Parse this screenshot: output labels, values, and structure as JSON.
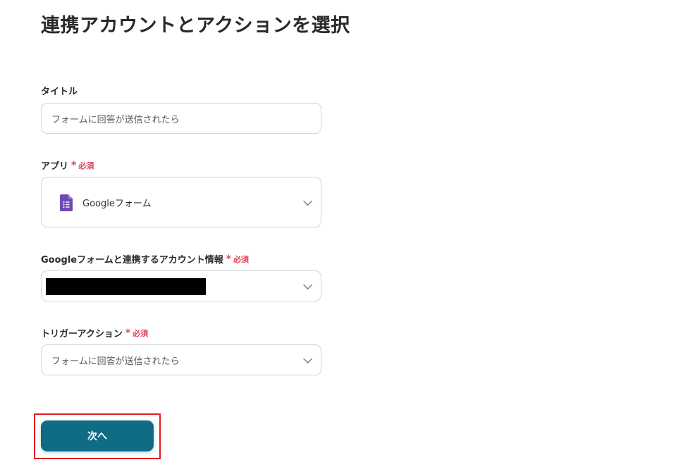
{
  "page": {
    "title": "連携アカウントとアクションを選択"
  },
  "fields": {
    "title_field": {
      "label": "タイトル",
      "value": "フォームに回答が送信されたら"
    },
    "app_field": {
      "label": "アプリ",
      "required_mark": "必須",
      "value": "Googleフォーム",
      "icon": "google-forms-icon"
    },
    "account_field": {
      "label": "Googleフォームと連携するアカウント情報",
      "required_mark": "必須",
      "value_redacted": true
    },
    "trigger_field": {
      "label": "トリガーアクション",
      "required_mark": "必須",
      "value": "フォームに回答が送信されたら"
    }
  },
  "actions": {
    "next_label": "次へ"
  },
  "colors": {
    "primary_button": "#106b85",
    "required": "#e0435a",
    "highlight_border": "#e11d22",
    "forms_purple": "#7248b9"
  }
}
